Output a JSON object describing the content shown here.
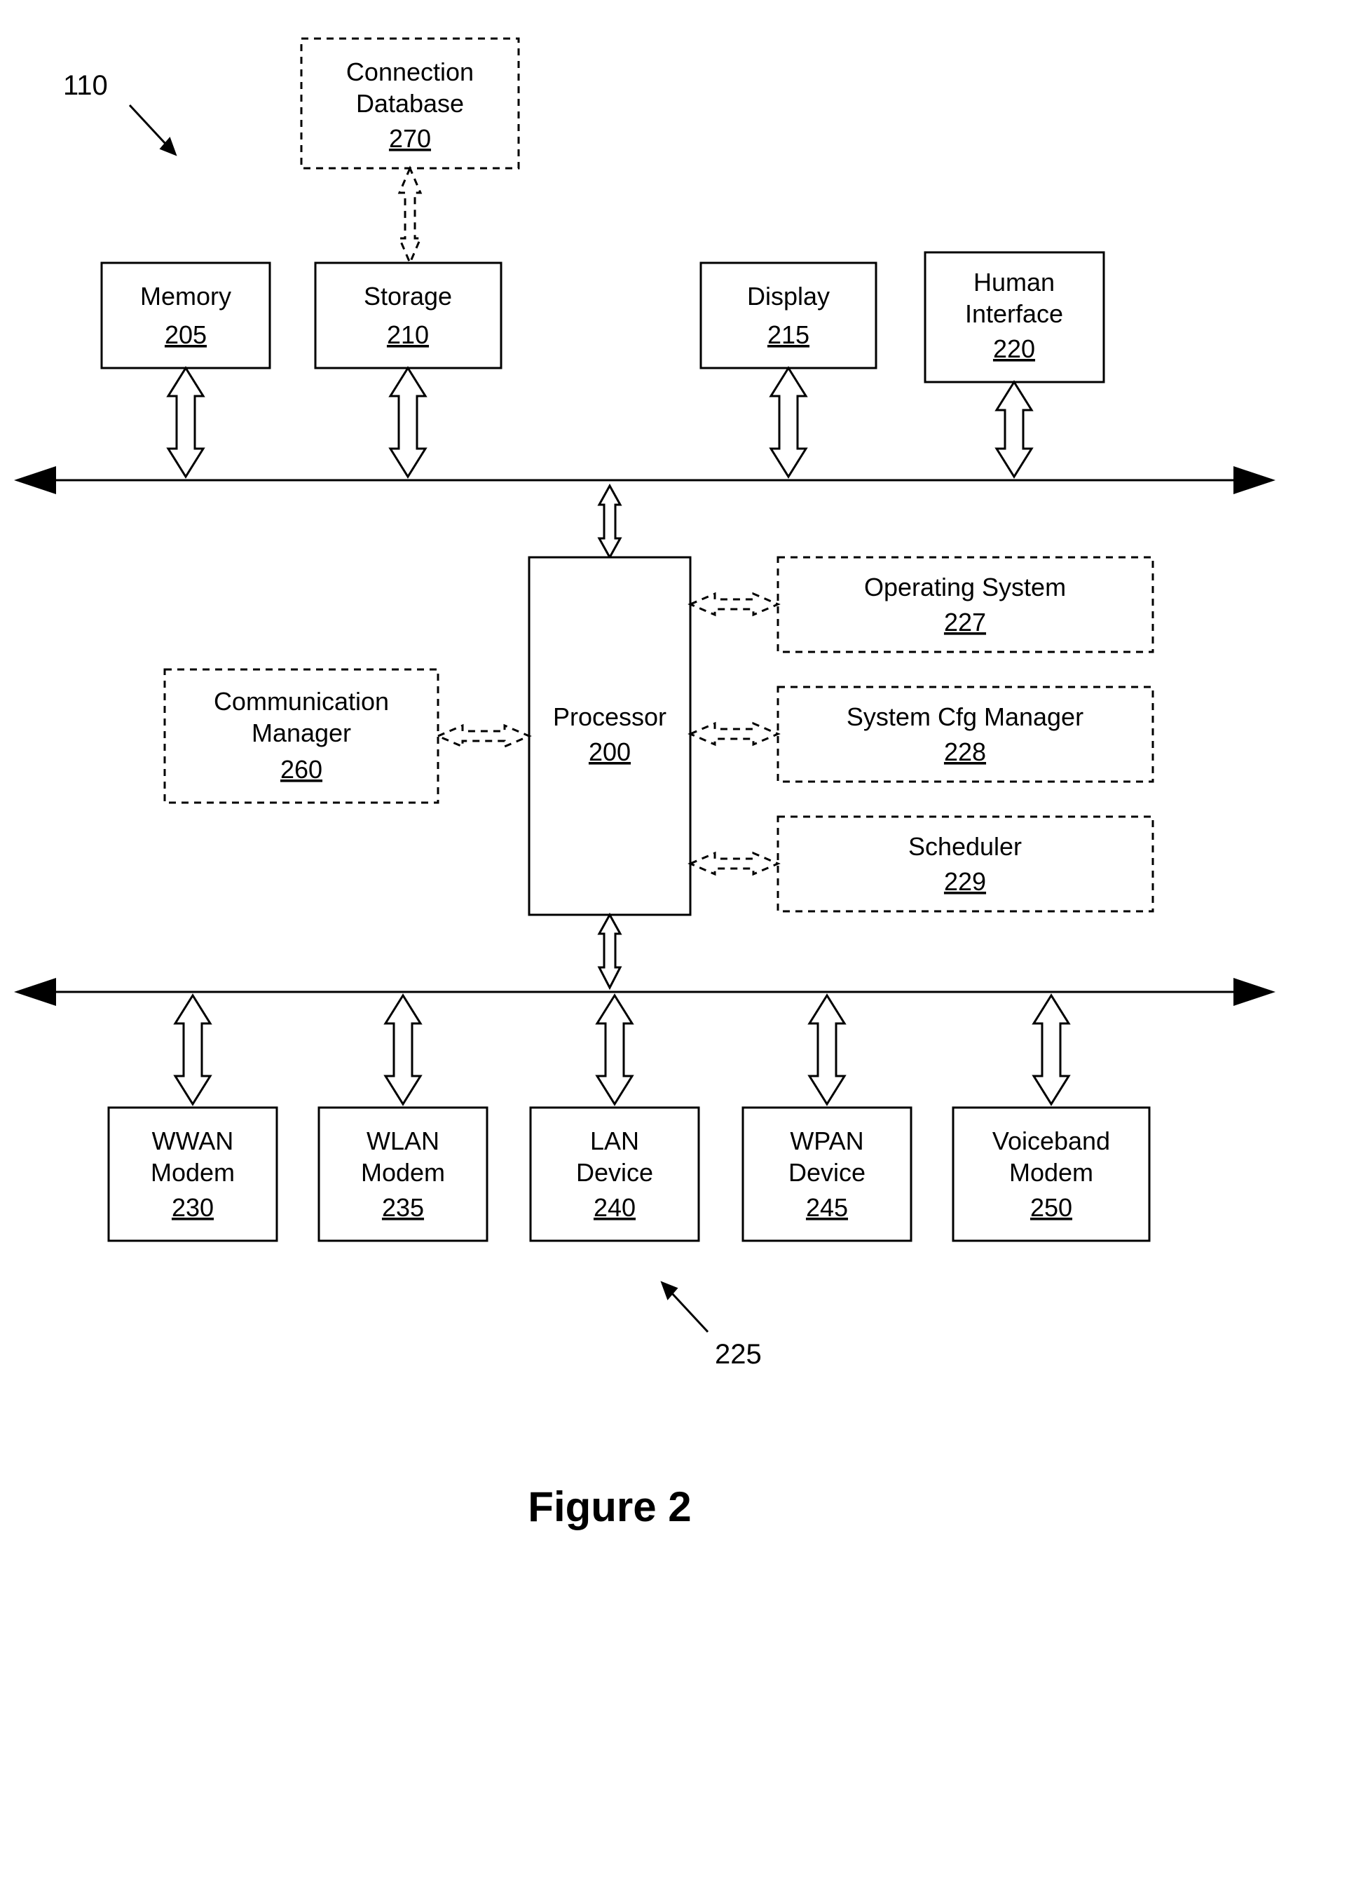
{
  "figure_label": "Figure 2",
  "ref110": "110",
  "ref225": "225",
  "boxes": {
    "connDB": {
      "l1": "Connection",
      "l2": "Database",
      "num": "270"
    },
    "memory": {
      "l1": "Memory",
      "num": "205"
    },
    "storage": {
      "l1": "Storage",
      "num": "210"
    },
    "display": {
      "l1": "Display",
      "num": "215"
    },
    "hi": {
      "l1": "Human",
      "l2": "Interface",
      "num": "220"
    },
    "commMgr": {
      "l1": "Communication",
      "l2": "Manager",
      "num": "260"
    },
    "proc": {
      "l1": "Processor",
      "num": "200"
    },
    "os": {
      "l1": "Operating System",
      "num": "227"
    },
    "syscfg": {
      "l1": "System Cfg Manager",
      "num": "228"
    },
    "sched": {
      "l1": "Scheduler",
      "num": "229"
    },
    "wwan": {
      "l1": "WWAN",
      "l2": "Modem",
      "num": "230"
    },
    "wlan": {
      "l1": "WLAN",
      "l2": "Modem",
      "num": "235"
    },
    "lan": {
      "l1": "LAN",
      "l2": "Device",
      "num": "240"
    },
    "wpan": {
      "l1": "WPAN",
      "l2": "Device",
      "num": "245"
    },
    "vband": {
      "l1": "Voiceband",
      "l2": "Modem",
      "num": "250"
    }
  }
}
